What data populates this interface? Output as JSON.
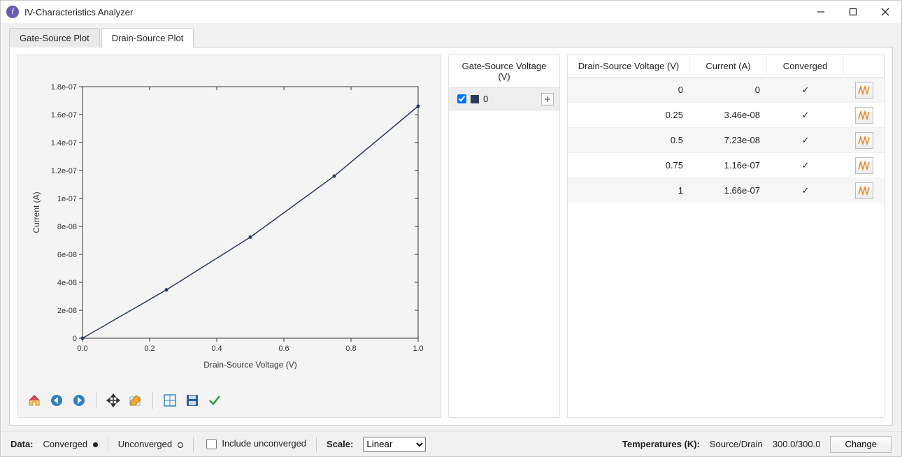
{
  "window": {
    "title": "IV-Characteristics Analyzer"
  },
  "tabs": [
    {
      "label": "Gate-Source Plot"
    },
    {
      "label": "Drain-Source Plot"
    }
  ],
  "active_tab": 1,
  "legend": {
    "title": "Gate-Source Voltage (V)",
    "items": [
      {
        "label": "0",
        "checked": true,
        "color": "#2b3b5c"
      }
    ]
  },
  "table": {
    "columns": [
      "Drain-Source Voltage (V)",
      "Current (A)",
      "Converged"
    ],
    "rows": [
      {
        "v": "0",
        "i": "0",
        "converged": "✓"
      },
      {
        "v": "0.25",
        "i": "3.46e-08",
        "converged": "✓"
      },
      {
        "v": "0.5",
        "i": "7.23e-08",
        "converged": "✓"
      },
      {
        "v": "0.75",
        "i": "1.16e-07",
        "converged": "✓"
      },
      {
        "v": "1",
        "i": "1.66e-07",
        "converged": "✓"
      }
    ]
  },
  "chart_data": {
    "type": "line",
    "xlabel": "Drain-Source Voltage (V)",
    "ylabel": "Current (A)",
    "xlim": [
      0.0,
      1.0
    ],
    "ylim": [
      0,
      1.8e-07
    ],
    "x_ticks": [
      "0.0",
      "0.2",
      "0.4",
      "0.6",
      "0.8",
      "1.0"
    ],
    "y_ticks": [
      "0",
      "2e-08",
      "4e-08",
      "6e-08",
      "8e-08",
      "1e-07",
      "1.2e-07",
      "1.4e-07",
      "1.6e-07",
      "1.8e-07"
    ],
    "series": [
      {
        "name": "0",
        "color": "#2b3b5c",
        "x": [
          0,
          0.25,
          0.5,
          0.75,
          1.0
        ],
        "y": [
          0,
          3.46e-08,
          7.23e-08,
          1.16e-07,
          1.66e-07
        ]
      }
    ]
  },
  "toolbar": {
    "home": "Home",
    "back": "Back",
    "forward": "Forward",
    "pan": "Pan",
    "edit": "Edit",
    "subplots": "Subplots",
    "save": "Save",
    "check": "Apply"
  },
  "status": {
    "data_label": "Data:",
    "converged": "Converged",
    "unconverged": "Unconverged",
    "include_unconverged": "Include unconverged",
    "scale_label": "Scale:",
    "scale_value": "Linear",
    "temps_label": "Temperatures (K):",
    "temps_sub": "Source/Drain",
    "temps_value": "300.0/300.0",
    "change_btn": "Change"
  }
}
